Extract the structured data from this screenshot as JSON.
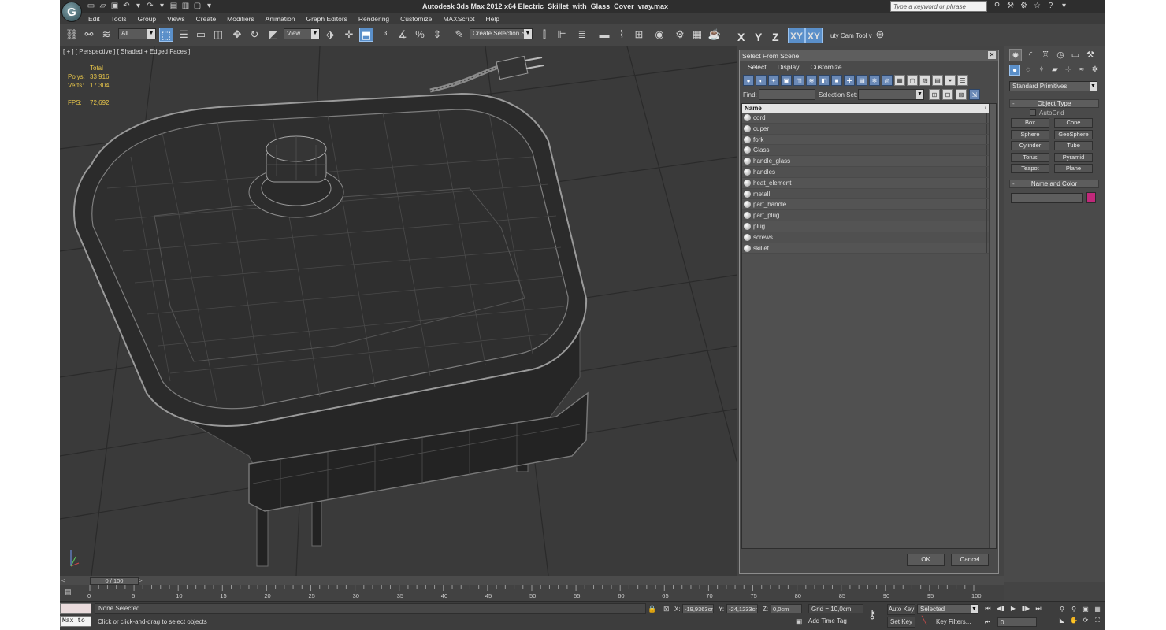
{
  "title_bar": {
    "app_logo": "G",
    "window_title": "Autodesk 3ds Max  2012 x64      Electric_Skillet_with_Glass_Cover_vray.max",
    "search_placeholder": "Type a keyword or phrase"
  },
  "menu": [
    "Edit",
    "Tools",
    "Group",
    "Views",
    "Create",
    "Modifiers",
    "Animation",
    "Graph Editors",
    "Rendering",
    "Customize",
    "MAXScript",
    "Help"
  ],
  "toolbar": {
    "filter_combo": "All",
    "reference_coord": "View",
    "create_selection_set": "Create Selection Se",
    "axis_x": "X",
    "axis_y": "Y",
    "axis_z": "Z",
    "axis_xy": "XY",
    "axis_xy2": "XY",
    "cam_tool": "uty Cam Tool v"
  },
  "viewport": {
    "label": "[ + ] [ Perspective ] [ Shaded + Edged Faces ]",
    "stats": {
      "total_label": "Total",
      "polys_label": "Polys:",
      "polys_value": "33 916",
      "verts_label": "Verts:",
      "verts_value": "17 304",
      "fps_label": "FPS:",
      "fps_value": "72,692"
    }
  },
  "dialog": {
    "title": "Select From Scene",
    "menus": [
      "Select",
      "Display",
      "Customize"
    ],
    "find_label": "Find:",
    "selection_set_label": "Selection Set:",
    "list_header": "Name",
    "sort_glyph": "/",
    "objects": [
      "cord",
      "cuper",
      "fork",
      "Glass",
      "handle_glass",
      "handles",
      "heat_element",
      "metall",
      "part_handle",
      "part_plug",
      "plug",
      "screws",
      "skillet"
    ],
    "ok": "OK",
    "cancel": "Cancel"
  },
  "command_panel": {
    "category": "Standard Primitives",
    "object_type_title": "Object Type",
    "autogrid": "AutoGrid",
    "primitives": [
      "Box",
      "Cone",
      "Sphere",
      "GeoSphere",
      "Cylinder",
      "Tube",
      "Torus",
      "Pyramid",
      "Teapot",
      "Plane"
    ],
    "name_color_title": "Name and Color",
    "swatch_color": "#c0287a"
  },
  "timeline": {
    "current": "0 / 100",
    "ticks": [
      "0",
      "5",
      "10",
      "15",
      "20",
      "25",
      "30",
      "35",
      "40",
      "45",
      "50",
      "55",
      "60",
      "65",
      "70",
      "75",
      "80",
      "85",
      "90",
      "95",
      "100"
    ]
  },
  "status": {
    "maxscript_label": "Max to",
    "selection": "None Selected",
    "prompt": "Click or click-and-drag to select objects",
    "x_label": "X:",
    "x_value": "-19,9363cr",
    "y_label": "Y:",
    "y_value": "-24,1233cr",
    "z_label": "Z:",
    "z_value": "0,0cm",
    "grid": "Grid = 10,0cm",
    "add_time_tag": "Add Time Tag",
    "auto_key": "Auto Key",
    "set_key": "Set Key",
    "selected": "Selected",
    "key_filters": "Key Filters...",
    "frame": "0"
  },
  "colors": {
    "accent": "#5a8fc9",
    "stats": "#e8c64a",
    "viewport_bg": "#3a3a3a"
  }
}
